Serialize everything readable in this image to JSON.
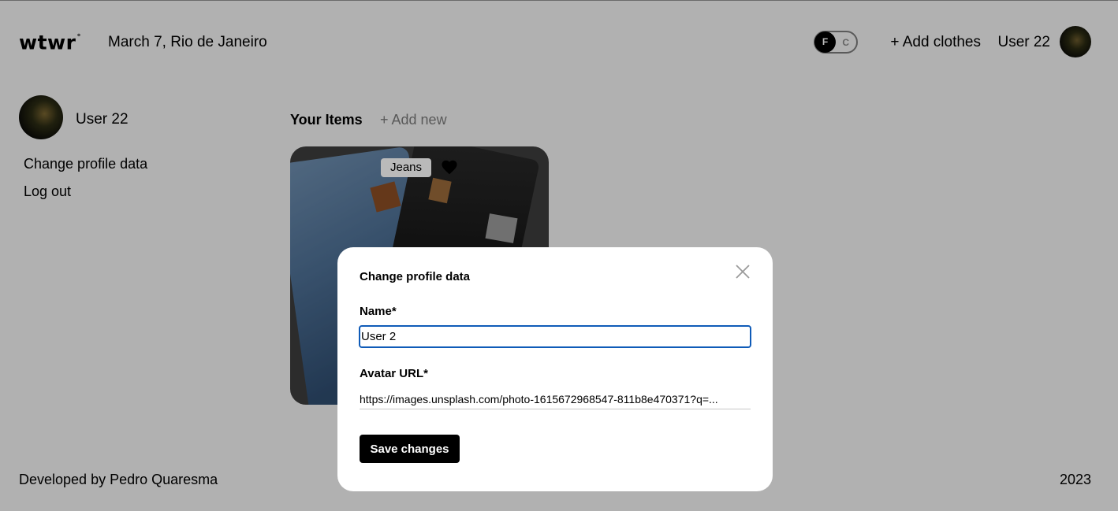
{
  "header": {
    "logo_text": "wtwr",
    "logo_mark": "°",
    "date_location": "March 7, Rio de Janeiro",
    "toggle_on_label": "F",
    "toggle_off_label": "C",
    "add_clothes_label": "+ Add clothes",
    "username": "User 22"
  },
  "sidebar": {
    "username": "User 22",
    "links": [
      "Change profile data",
      "Log out"
    ]
  },
  "items": {
    "title": "Your Items",
    "add_new_label": "+ Add new",
    "cards": [
      {
        "name": "Jeans",
        "liked": true
      }
    ]
  },
  "modal": {
    "title": "Change profile data",
    "name_label": "Name*",
    "name_value": "User 2",
    "avatar_label": "Avatar URL*",
    "avatar_value": "https://images.unsplash.com/photo-1615672968547-811b8e470371?q=...",
    "save_label": "Save changes"
  },
  "footer": {
    "credit": "Developed by Pedro Quaresma",
    "year": "2023"
  },
  "colors": {
    "focus_border": "#0f5bb8",
    "overlay": "rgba(0,0,0,0.27)",
    "button_bg": "#000000"
  },
  "icons": {
    "close": "close-icon",
    "like": "heart-icon"
  }
}
